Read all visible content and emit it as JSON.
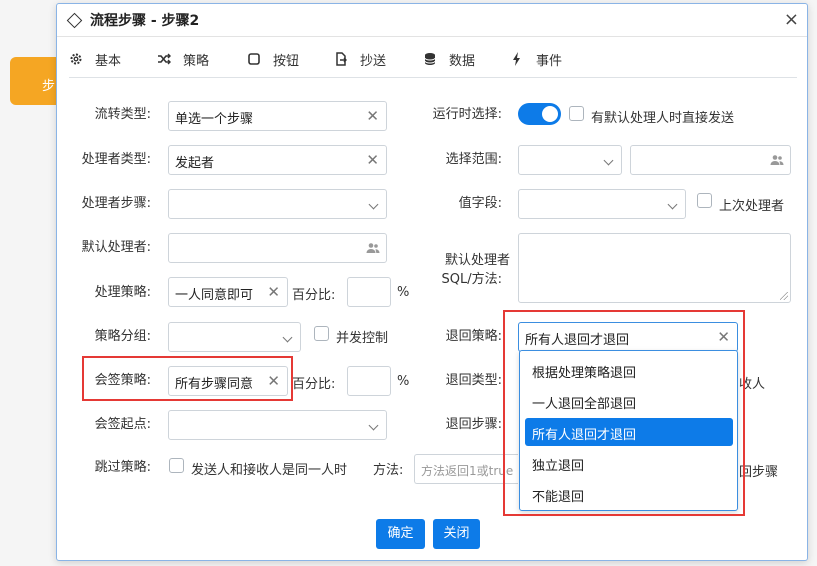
{
  "bg_node": {
    "label": "步"
  },
  "dialog": {
    "title": "流程步骤 - 步骤2",
    "close": "×"
  },
  "tabs": [
    {
      "label": "基本",
      "icon": "gear-icon"
    },
    {
      "label": "策略",
      "icon": "shuffle-icon"
    },
    {
      "label": "按钮",
      "icon": "square-icon"
    },
    {
      "label": "抄送",
      "icon": "share-file-icon"
    },
    {
      "label": "数据",
      "icon": "database-icon"
    },
    {
      "label": "事件",
      "icon": "bolt-icon"
    }
  ],
  "left": {
    "flow_type": {
      "label": "流转类型:",
      "value": "单选一个步骤"
    },
    "handler_type": {
      "label": "处理者类型:",
      "value": "发起者"
    },
    "handler_step": {
      "label": "处理者步骤:",
      "value": ""
    },
    "default_handler": {
      "label": "默认处理者:",
      "value": ""
    },
    "handle_policy": {
      "label": "处理策略:",
      "value": "一人同意即可",
      "percent_label": "百分比:",
      "percent_value": "",
      "unit": "%"
    },
    "policy_group": {
      "label": "策略分组:",
      "value": "",
      "concurrent_label": "并发控制"
    },
    "countersign_policy": {
      "label": "会签策略:",
      "value": "所有步骤同意",
      "percent_label": "百分比:",
      "percent_value": "",
      "unit": "%"
    },
    "countersign_start": {
      "label": "会签起点:",
      "value": ""
    },
    "skip_policy": {
      "label": "跳过策略:",
      "skip_option": "发送人和接收人是同一人时",
      "method_label": "方法:",
      "method_placeholder": "方法返回1或true"
    }
  },
  "right": {
    "runtime_select": {
      "label": "运行时选择:",
      "on": true,
      "direct_send_label": "有默认处理人时直接发送"
    },
    "select_scope": {
      "label": "选择范围:"
    },
    "value_field": {
      "label": "值字段:",
      "last_handler_label": "上次处理者"
    },
    "default_sql": {
      "label_line1": "默认处理者",
      "label_line2": "SQL/方法:"
    },
    "return_policy": {
      "label": "退回策略:",
      "value": "所有人退回才退回"
    },
    "return_type": {
      "label": "退回类型:",
      "partial_text": "收人"
    },
    "return_step": {
      "label": "退回步骤:",
      "partial_text": "回步骤"
    },
    "dropdown_options": [
      {
        "label": "根据处理策略退回",
        "selected": false
      },
      {
        "label": "一人退回全部退回",
        "selected": false
      },
      {
        "label": "所有人退回才退回",
        "selected": true
      },
      {
        "label": "独立退回",
        "selected": false
      },
      {
        "label": "不能退回",
        "selected": false
      }
    ]
  },
  "buttons": {
    "confirm": "确定",
    "close": "关闭"
  },
  "colors": {
    "accent": "#0d7be8",
    "highlight": "#e53935",
    "node": "#f5a623"
  }
}
